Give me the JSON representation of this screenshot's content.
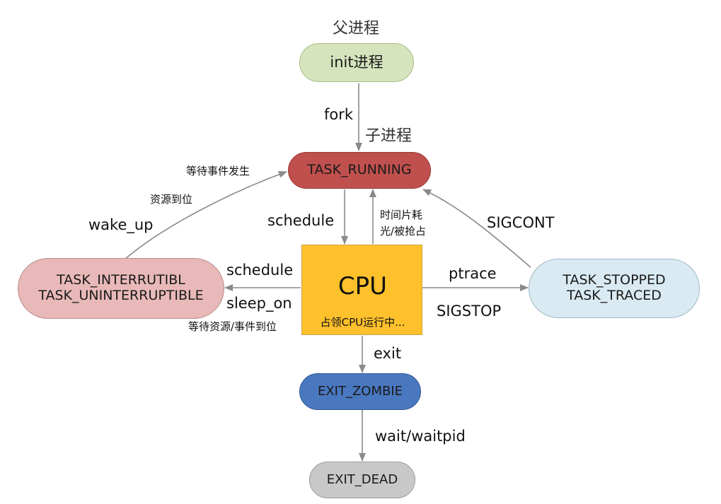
{
  "parent_label": "父进程",
  "child_label": "子进程",
  "nodes": {
    "init": {
      "label": "init进程",
      "color": "#d6e4bd"
    },
    "running": {
      "label": "TASK_RUNNING",
      "color": "#c0504d"
    },
    "cpu": {
      "title": "CPU",
      "subtitle": "占领CPU运行中...",
      "color": "#ffc12b"
    },
    "interruptible": {
      "line1": "TASK_INTERRUTIBL",
      "line2": "TASK_UNINTERRUPTIBLE",
      "color": "#e8b9b8"
    },
    "stopped": {
      "line1": "TASK_STOPPED",
      "line2": "TASK_TRACED",
      "color": "#d9eaf2"
    },
    "zombie": {
      "label": "EXIT_ZOMBIE",
      "color": "#4a78c0"
    },
    "dead": {
      "label": "EXIT_DEAD",
      "color": "#c8c8c8"
    }
  },
  "edges": {
    "fork": "fork",
    "schedule_down": "schedule",
    "timeslice_line1": "时间片耗",
    "timeslice_line2": "光/被抢占",
    "wait_event": "等待事件发生",
    "resource_ready": "资源到位",
    "wake_up": "wake_up",
    "schedule_left": "schedule",
    "sleep_on": "sleep_on",
    "wait_resource": "等待资源/事件到位",
    "ptrace": "ptrace",
    "sigstop": "SIGSTOP",
    "sigcont": "SIGCONT",
    "exit": "exit",
    "wait_pid": "wait/waitpid"
  }
}
